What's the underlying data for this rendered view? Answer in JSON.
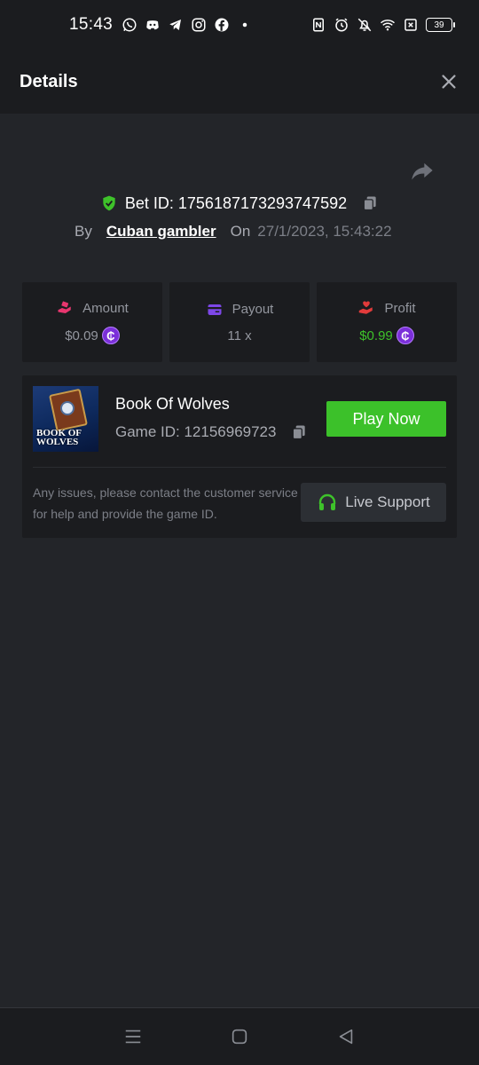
{
  "status_bar": {
    "time": "15:43",
    "left_icons": [
      "whatsapp-icon",
      "discord-icon",
      "telegram-icon",
      "instagram-icon",
      "facebook-icon",
      "dot-icon"
    ],
    "right_icons": [
      "nfc-icon",
      "alarm-icon",
      "bell-off-icon",
      "wifi-icon",
      "sim-x-icon"
    ],
    "battery": "39"
  },
  "header": {
    "title": "Details",
    "close_icon": "close-icon"
  },
  "bet": {
    "id_label": "Bet ID: 1756187173293747592",
    "by_label": "By",
    "user": "Cuban gambler",
    "on_label": "On",
    "datetime": "27/1/2023, 15:43:22"
  },
  "stats": {
    "amount": {
      "label": "Amount",
      "value": "$0.09",
      "icon": "hand-coins-icon",
      "color": "#e8366f"
    },
    "payout": {
      "label": "Payout",
      "value": "11 x",
      "icon": "card-icon",
      "color": "#7d47e8"
    },
    "profit": {
      "label": "Profit",
      "value": "$0.99",
      "icon": "hand-heart-icon",
      "color": "#e23b3b",
      "value_color": "#3ec22a"
    }
  },
  "coin_symbol": "₵",
  "game": {
    "name": "Book Of Wolves",
    "id_label": "Game ID: 12156969723",
    "thumb_text": "BOOK OF WOLVES",
    "play_label": "Play Now",
    "support_text": "Any issues, please contact the customer service for help and provide the game ID.",
    "support_label": "Live Support"
  },
  "colors": {
    "background": "#232529",
    "panel": "#1b1c1f",
    "accent_green": "#3cc12a",
    "coin": "#7b2fd9"
  },
  "nav": [
    "menu-icon",
    "home-icon",
    "back-icon"
  ]
}
